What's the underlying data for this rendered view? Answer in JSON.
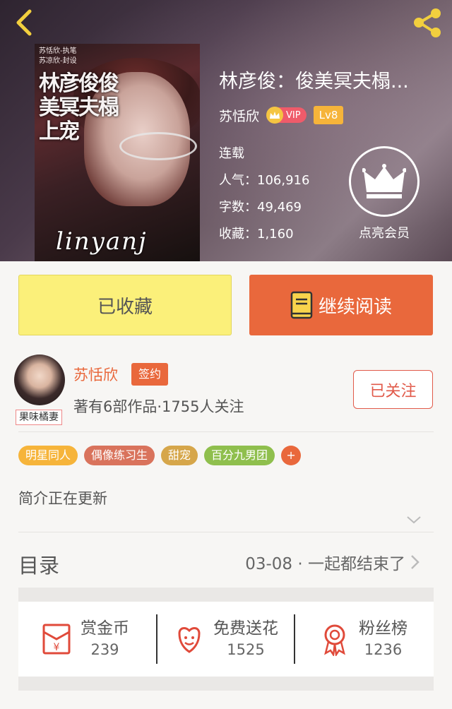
{
  "header": {
    "back_icon": "chevron-left-icon",
    "share_icon": "share-icon"
  },
  "book": {
    "cover_credits": [
      "苏恬欣-执笔",
      "苏凉欣-封设"
    ],
    "cover_title_art": "林彦俊俊美冥夫榻上宠",
    "cover_signature": "linyanj",
    "title": "林彦俊：俊美冥夫榻...",
    "author": "苏恬欣",
    "vip_label": "VIP",
    "level": "Lv8",
    "status": "连载",
    "popularity_label": "人气：106,916",
    "word_count_label": "字数：49,469",
    "favorites_label": "收藏：1,160"
  },
  "member": {
    "icon": "crown-icon",
    "label": "点亮会员"
  },
  "actions": {
    "favorited_label": "已收藏",
    "continue_label": "继续阅读",
    "book_icon": "book-icon"
  },
  "author_card": {
    "avatar_tag": "果味橘妻",
    "name": "苏恬欣",
    "signed_badge": "签约",
    "meta": "著有6部作品·1755人关注",
    "follow_label": "已关注"
  },
  "tags": [
    {
      "label": "明星同人",
      "color": "#f6b43a"
    },
    {
      "label": "偶像练习生",
      "color": "#d9735c"
    },
    {
      "label": "甜宠",
      "color": "#d6a64a"
    },
    {
      "label": "百分九男团",
      "color": "#8fbf4d"
    }
  ],
  "tag_more": "+",
  "intro": {
    "text": "简介正在更新",
    "expand_icon": "chevron-down-icon"
  },
  "toc": {
    "label": "目录",
    "latest": "03-08 · 一起都结束了",
    "arrow_icon": "chevron-right-icon"
  },
  "rewards": [
    {
      "label": "赏金币",
      "value": "239",
      "icon": "red-envelope-icon"
    },
    {
      "label": "免费送花",
      "value": "1525",
      "icon": "flower-icon"
    },
    {
      "label": "粉丝榜",
      "value": "1236",
      "icon": "medal-icon"
    }
  ],
  "colors": {
    "accent": "#e9683c",
    "favorite_bg": "#fbf07a",
    "follow_border": "#e15a4a"
  }
}
